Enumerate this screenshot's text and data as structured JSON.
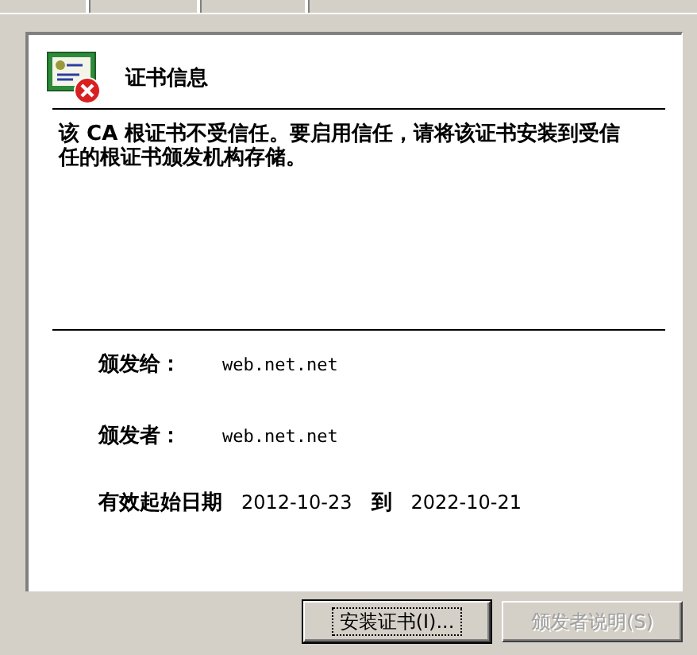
{
  "certificate": {
    "title": "证书信息",
    "message": "该 CA 根证书不受信任。要启用信任，请将该证书安装到受信任的根证书颁发机构存储。",
    "issued_to_label": "颁发给：",
    "issued_to": "web.net.net",
    "issued_by_label": "颁发者：",
    "issued_by": "web.net.net",
    "validity_label": "有效起始日期",
    "valid_from": "2012-10-23",
    "to_label": "到",
    "valid_to": "2022-10-21"
  },
  "buttons": [
    {
      "label": "安装证书(I)...",
      "disabled": false,
      "focused": true
    },
    {
      "label": "颁发者说明(S)",
      "disabled": true,
      "focused": false
    }
  ]
}
